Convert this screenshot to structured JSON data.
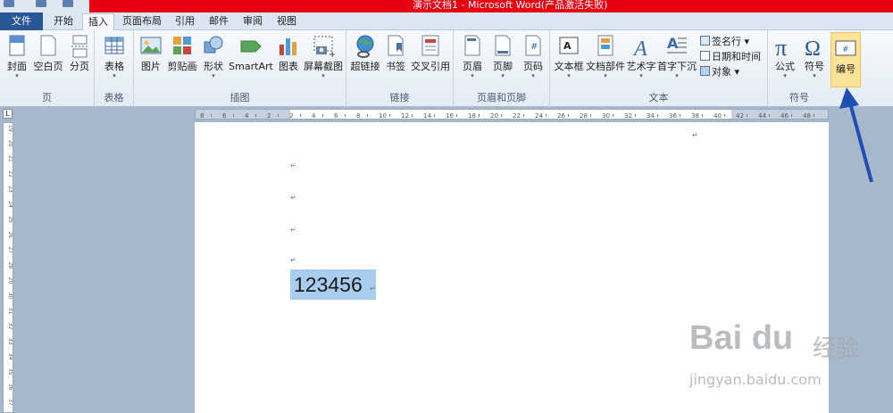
{
  "window": {
    "title": "演示文档1 - Microsoft Word(产品激活失败)"
  },
  "tabs": [
    "文件",
    "开始",
    "插入",
    "页面布局",
    "引用",
    "邮件",
    "审阅",
    "视图"
  ],
  "active_tab": "插入",
  "ribbon": {
    "groups": {
      "pages": {
        "label": "页",
        "buttons": [
          "封面",
          "空白页",
          "分页"
        ]
      },
      "tables": {
        "label": "表格",
        "buttons": [
          "表格"
        ]
      },
      "illustrations": {
        "label": "插图",
        "buttons": [
          "图片",
          "剪贴画",
          "形状",
          "SmartArt",
          "图表",
          "屏幕截图"
        ]
      },
      "links": {
        "label": "链接",
        "buttons": [
          "超链接",
          "书签",
          "交叉引用"
        ]
      },
      "header_footer": {
        "label": "页眉和页脚",
        "buttons": [
          "页眉",
          "页脚",
          "页码"
        ]
      },
      "text": {
        "label": "文本",
        "buttons": [
          "文本框",
          "文档部件",
          "艺术字",
          "首字下沉"
        ],
        "small": [
          "签名行",
          "日期和时间",
          "对象"
        ]
      },
      "symbols": {
        "label": "符号",
        "buttons": [
          "公式",
          "符号",
          "编号"
        ]
      }
    }
  },
  "ruler": {
    "h_labels": [
      "8",
      "6",
      "4",
      "2",
      "2",
      "4",
      "6",
      "8",
      "10",
      "12",
      "14",
      "16",
      "18",
      "20",
      "22",
      "24",
      "26",
      "28",
      "30",
      "32",
      "34",
      "36",
      "38",
      "40",
      "42",
      "44",
      "46",
      "48"
    ],
    "v_labels": [
      "19",
      "20",
      "21",
      "22",
      "23",
      "24",
      "25",
      "26",
      "27",
      "28",
      "29",
      "30",
      "31",
      "32",
      "33",
      "34",
      "35",
      "36",
      "37"
    ]
  },
  "document": {
    "paragraph_mark": "↵",
    "selected_text": "123456"
  },
  "watermark": {
    "brand": "Bai du",
    "cn": "经验",
    "url": "jingyan.baidu.com"
  },
  "colors": {
    "title_bar": "#e60012",
    "file_tab": "#2b5797",
    "highlight": "#fbe49a",
    "selection": "#a8cdee",
    "arrow": "#1f4fb3"
  }
}
